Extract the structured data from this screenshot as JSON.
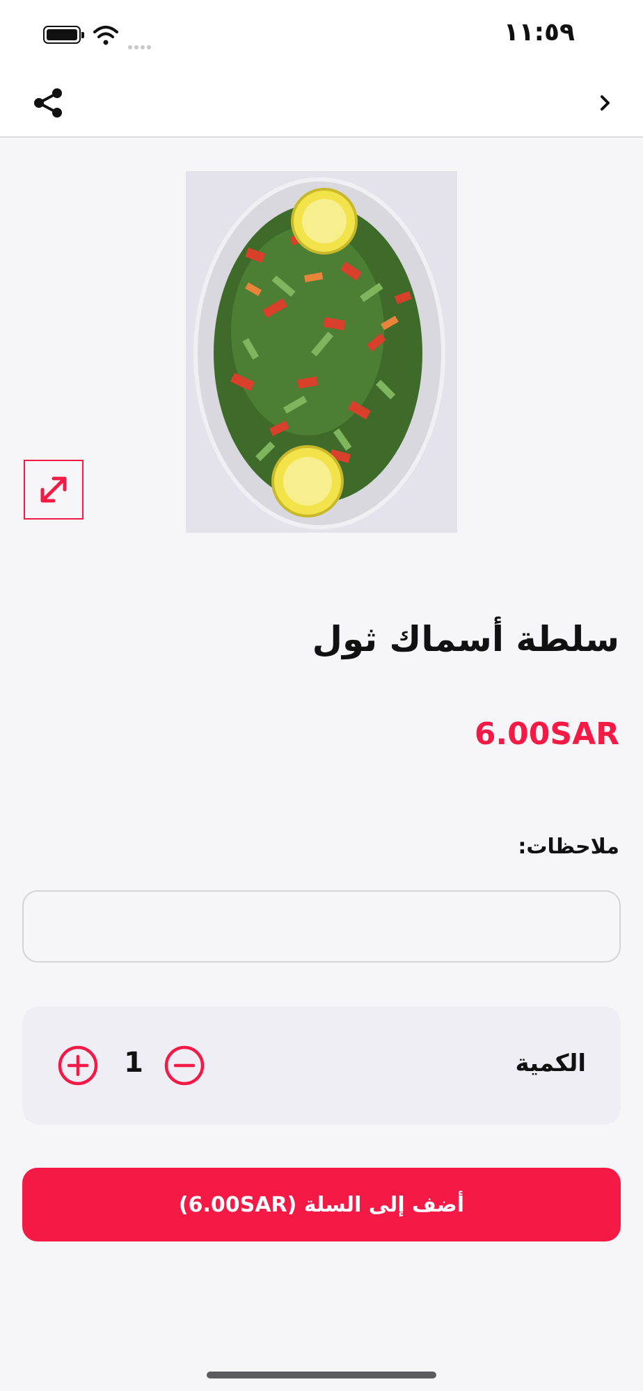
{
  "status_bar": {
    "time": "١١:٥٩"
  },
  "product": {
    "title": "سلطة أسماك ثول",
    "price": "6.00SAR",
    "image_icon": "salad-photo"
  },
  "notes": {
    "label": "ملاحظات:",
    "value": "",
    "placeholder": ""
  },
  "quantity": {
    "label": "الكمية",
    "value": "1"
  },
  "cart": {
    "button_label": "أضف إلى السلة (6.00SAR)"
  },
  "icons": {
    "share": "share-icon",
    "back": "chevron-right-icon",
    "expand": "expand-icon",
    "plus": "plus-circle-icon",
    "minus": "minus-circle-icon"
  },
  "colors": {
    "accent": "#f51a45",
    "background": "#f6f6f8",
    "quantity_bg": "#efeef4"
  }
}
